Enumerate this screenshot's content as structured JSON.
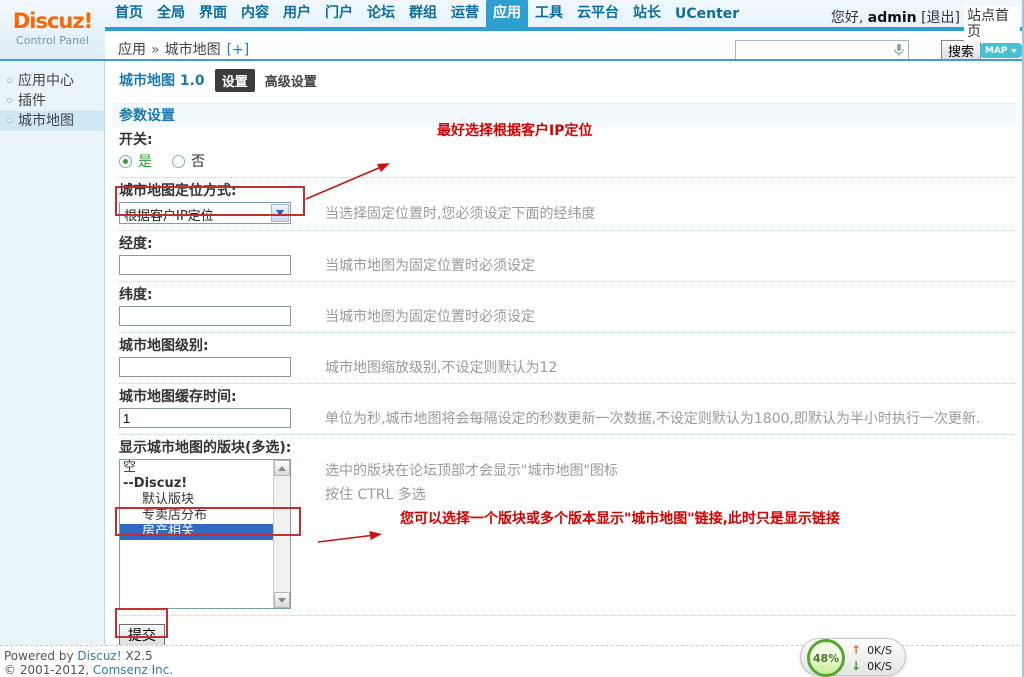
{
  "header": {
    "logo": {
      "title": "Discuz!",
      "subtitle": "Control Panel"
    },
    "nav": {
      "items": [
        "首页",
        "全局",
        "界面",
        "内容",
        "用户",
        "门户",
        "论坛",
        "群组",
        "运营",
        "应用",
        "工具",
        "云平台",
        "站长",
        "UCenter"
      ],
      "active": "应用"
    },
    "user": {
      "greeting": "您好,",
      "username": "admin",
      "logout": "[退出]",
      "site_home": "站点首页"
    },
    "breadcrumb": {
      "section": "应用",
      "separator": "»",
      "page": "城市地图",
      "expand": "[+]"
    },
    "search": {
      "value": "",
      "button": "搜索",
      "map_badge": "MAP"
    }
  },
  "sidebar": {
    "items": [
      {
        "label": "应用中心",
        "active": false
      },
      {
        "label": "插件",
        "active": false
      },
      {
        "label": "城市地图",
        "active": true
      }
    ]
  },
  "main": {
    "title": "城市地图 1.0",
    "tabs": [
      {
        "label": "设置",
        "active": true
      },
      {
        "label": "高级设置",
        "active": false
      }
    ],
    "section_title": "参数设置",
    "fields": [
      {
        "label": "开关:",
        "type": "radio",
        "options": [
          {
            "label": "是",
            "checked": true
          },
          {
            "label": "否",
            "checked": false
          }
        ]
      },
      {
        "label": "城市地图定位方式:",
        "type": "select",
        "value": "根据客户IP定位",
        "hint": "当选择固定位置时,您必须设定下面的经纬度"
      },
      {
        "label": "经度:",
        "type": "text",
        "value": "",
        "hint": "当城市地图为固定位置时必须设定"
      },
      {
        "label": "纬度:",
        "type": "text",
        "value": "",
        "hint": "当城市地图为固定位置时必须设定"
      },
      {
        "label": "城市地图级别:",
        "type": "text",
        "value": "",
        "hint": "城市地图缩放级别,不设定则默认为12"
      },
      {
        "label": "城市地图缓存时间:",
        "type": "text",
        "value": "1",
        "hint": "单位为秒,城市地图将会每隔设定的秒数更新一次数据,不设定则默认为1800,即默认为半小时执行一次更新."
      },
      {
        "label": "显示城市地图的版块(多选):",
        "type": "multiselect",
        "options": [
          {
            "label": "空",
            "style": "plain",
            "selected": false
          },
          {
            "label": "--Discuz!",
            "style": "bold",
            "selected": false
          },
          {
            "label": "默认版块",
            "style": "indent",
            "selected": false
          },
          {
            "label": "专卖店分布",
            "style": "indent",
            "selected": false
          },
          {
            "label": "房产相关",
            "style": "indent",
            "selected": true
          }
        ],
        "hints": [
          "选中的版块在论坛顶部才会显示\"城市地图\"图标",
          "按住 CTRL 多选"
        ]
      }
    ],
    "submit_label": "提交"
  },
  "annotations": {
    "note1": "最好选择根据客户IP定位",
    "note2": "您可以选择一个版块或多个版本显示\"城市地图\"链接,此时只是显示链接"
  },
  "footer": {
    "powered_prefix": "Powered by",
    "powered_link": "Discuz!",
    "powered_suffix": "X2.5",
    "copyright_prefix": "© 2001-2012,",
    "copyright_link": "Comsenz Inc."
  },
  "widget": {
    "percent": "48%",
    "up_icon": "↑",
    "up_speed": "0K/S",
    "down_icon": "↓",
    "down_speed": "0K/S"
  }
}
